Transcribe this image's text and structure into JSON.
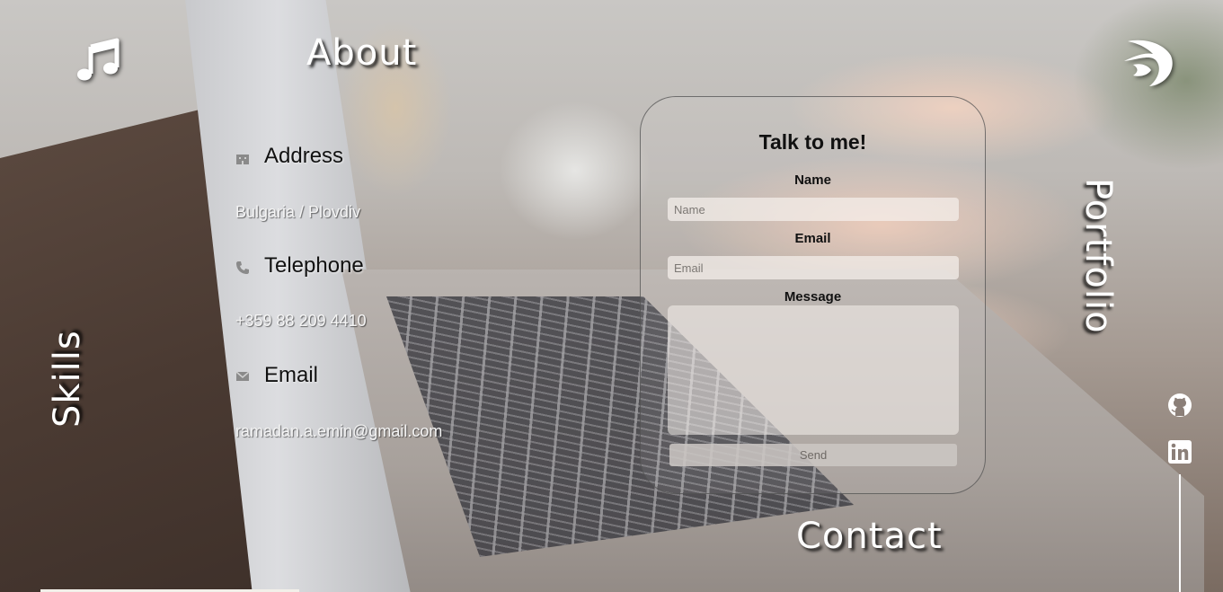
{
  "nav": {
    "about": "About",
    "contact": "Contact",
    "skills": "Skills",
    "portfolio": "Portfolio"
  },
  "icons": {
    "music": "music-note-icon",
    "logo": "swoosh-logo-icon",
    "address": "building-icon",
    "telephone": "phone-icon",
    "email": "envelope-icon",
    "github": "github-icon",
    "linkedin": "linkedin-icon"
  },
  "about": {
    "address_heading": "Address",
    "address_value": "Bulgaria / Plovdiv",
    "telephone_heading": "Telephone",
    "telephone_value": "+359 88 209 4410",
    "email_heading": "Email",
    "email_value": "ramadan.a.emin@gmail.com"
  },
  "form": {
    "title": "Talk to me!",
    "name_label": "Name",
    "name_placeholder": "Name",
    "email_label": "Email",
    "email_placeholder": "Email",
    "message_label": "Message",
    "send_label": "Send"
  },
  "colors": {
    "nav_text": "#ffffff",
    "heading_text": "#111111",
    "accent_line": "#ffffff"
  }
}
